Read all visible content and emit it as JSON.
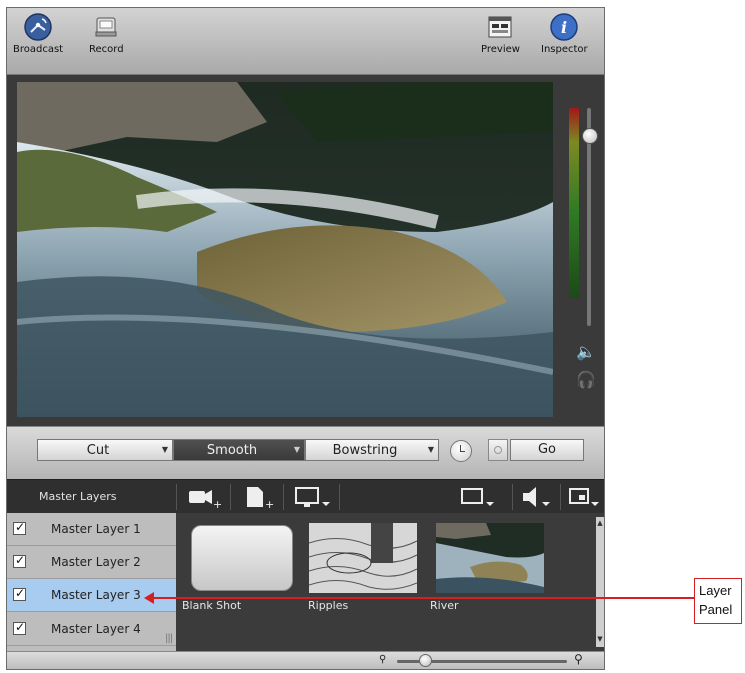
{
  "toolbar": {
    "broadcast_label": "Broadcast",
    "record_label": "Record",
    "preview_label": "Preview",
    "inspector_label": "Inspector"
  },
  "transitions": {
    "cut_label": "Cut",
    "smooth_label": "Smooth",
    "bowstring_label": "Bowstring",
    "go_label": "Go",
    "selected": "Smooth"
  },
  "layer_panel": {
    "header_title": "Master Layers",
    "layers": [
      {
        "label": "Master Layer 1",
        "checked": true,
        "selected": false
      },
      {
        "label": "Master Layer 2",
        "checked": true,
        "selected": false
      },
      {
        "label": "Master Layer 3",
        "checked": true,
        "selected": true
      },
      {
        "label": "Master Layer 4",
        "checked": true,
        "selected": false
      }
    ],
    "shots": [
      {
        "label": "Blank Shot"
      },
      {
        "label": "Ripples"
      },
      {
        "label": "River"
      }
    ]
  },
  "annotation": {
    "line1": "Layer",
    "line2": "Panel",
    "color": "#d42020"
  },
  "colors": {
    "selected_row": "#a8ccf0",
    "panel_dark": "#3b3b3b"
  }
}
